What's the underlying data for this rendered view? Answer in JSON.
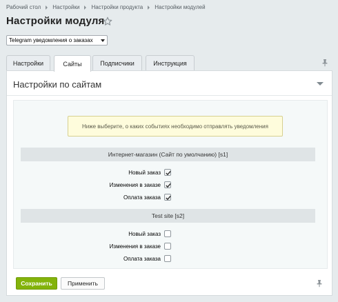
{
  "breadcrumb": [
    "Рабочий стол",
    "Настройки",
    "Настройки продукта",
    "Настройки модулей"
  ],
  "page": {
    "title": "Настройки модуля"
  },
  "module_select": {
    "value": "Telegram уведомления о заказах"
  },
  "tabs": [
    {
      "label": "Настройки",
      "active": false
    },
    {
      "label": "Сайты",
      "active": true
    },
    {
      "label": "Подписчики",
      "active": false
    },
    {
      "label": "Инструкция",
      "active": false
    }
  ],
  "panel": {
    "title": "Настройки по сайтам",
    "note": "Ниже выберите, о каких событиях необходимо отправлять уведомления",
    "sites": [
      {
        "name": "Интернет-магазин (Сайт по умолчанию) [s1]",
        "fields": [
          {
            "label": "Новый заказ",
            "checked": true
          },
          {
            "label": "Изменения в заказе",
            "checked": true
          },
          {
            "label": "Оплата заказа",
            "checked": true
          }
        ]
      },
      {
        "name": "Test site [s2]",
        "fields": [
          {
            "label": "Новый заказ",
            "checked": false
          },
          {
            "label": "Изменения в заказе",
            "checked": false
          },
          {
            "label": "Оплата заказа",
            "checked": false
          }
        ]
      }
    ]
  },
  "buttons": {
    "save": "Сохранить",
    "apply": "Применить"
  },
  "colors": {
    "save_button": "#83b30b",
    "background": "#e6ebed",
    "note_background": "#fefcdc"
  }
}
